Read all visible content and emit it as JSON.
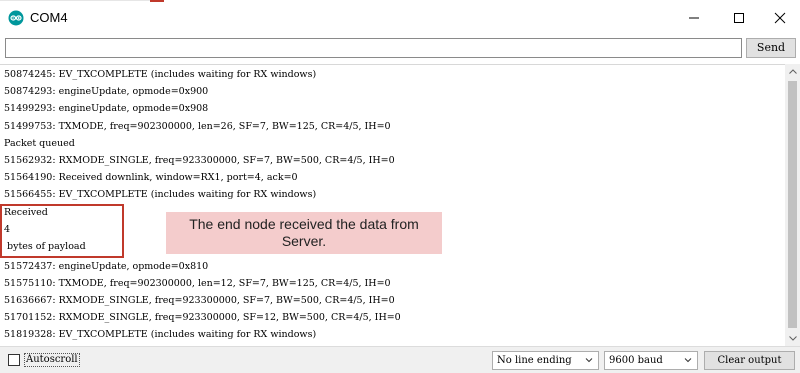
{
  "window": {
    "title": "COM4",
    "icon": "arduino-infinity-icon",
    "accent_color": "#00979c"
  },
  "send": {
    "input_value": "",
    "button_label": "Send"
  },
  "console": {
    "lines": [
      "50874245: EV_TXCOMPLETE (includes waiting for RX windows)",
      "50874293: engineUpdate, opmode=0x900",
      "51499293: engineUpdate, opmode=0x908",
      "51499753: TXMODE, freq=902300000, len=26, SF=7, BW=125, CR=4/5, IH=0",
      "Packet queued",
      "51562932: RXMODE_SINGLE, freq=923300000, SF=7, BW=500, CR=4/5, IH=0",
      "51564190: Received downlink, window=RX1, port=4, ack=0",
      "51566455: EV_TXCOMPLETE (includes waiting for RX windows)",
      "Received",
      "4",
      " bytes of payload",
      "51572437: engineUpdate, opmode=0x810",
      "51575110: TXMODE, freq=902300000, len=12, SF=7, BW=125, CR=4/5, IH=0",
      "51636667: RXMODE_SINGLE, freq=923300000, SF=7, BW=500, CR=4/5, IH=0",
      "51701152: RXMODE_SINGLE, freq=923300000, SF=12, BW=500, CR=4/5, IH=0",
      "51819328: EV_TXCOMPLETE (includes waiting for RX windows)"
    ],
    "annotation": "The end node received the data from Server.",
    "highlight_color": "#c0392b",
    "annotation_bg": "#f4cccc"
  },
  "bottom": {
    "autoscroll_label": "Autoscroll",
    "autoscroll_checked": false,
    "line_ending": "No line ending",
    "baud": "9600 baud",
    "clear_label": "Clear output"
  }
}
